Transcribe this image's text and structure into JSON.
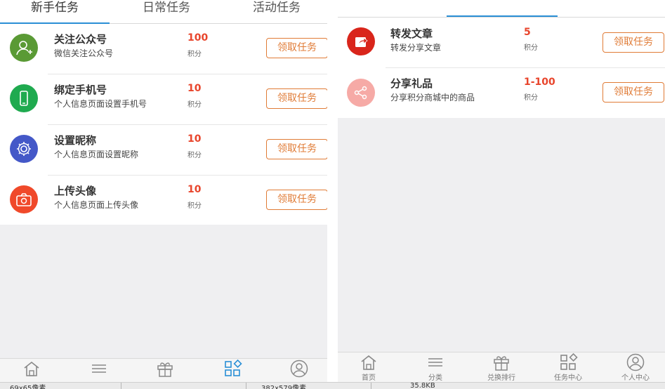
{
  "left_panel": {
    "tabs": [
      {
        "label": "新手任务",
        "active": true
      },
      {
        "label": "日常任务",
        "active": false
      },
      {
        "label": "活动任务",
        "active": false
      }
    ],
    "tasks": [
      {
        "title": "关注公众号",
        "desc": "微信关注公众号",
        "points": "100",
        "unit": "积分",
        "button": "领取任务",
        "icon": "user-add-icon",
        "color": "#5a9a35"
      },
      {
        "title": "绑定手机号",
        "desc": "个人信息页面设置手机号",
        "points": "10",
        "unit": "积分",
        "button": "领取任务",
        "icon": "phone-icon",
        "color": "#1faa4f"
      },
      {
        "title": "设置昵称",
        "desc": "个人信息页面设置昵称",
        "points": "10",
        "unit": "积分",
        "button": "领取任务",
        "icon": "gear-icon",
        "color": "#4458c8"
      },
      {
        "title": "上传头像",
        "desc": "个人信息页面上传头像",
        "points": "10",
        "unit": "积分",
        "button": "领取任务",
        "icon": "camera-icon",
        "color": "#f0492a"
      }
    ],
    "nav": [
      {
        "icon": "home-icon",
        "label": ""
      },
      {
        "icon": "menu-icon",
        "label": ""
      },
      {
        "icon": "gift-icon",
        "label": ""
      },
      {
        "icon": "task-grid-icon",
        "label": "",
        "active": true
      },
      {
        "icon": "user-icon",
        "label": ""
      }
    ]
  },
  "right_panel": {
    "tasks": [
      {
        "title": "转发文章",
        "desc": "转发分享文章",
        "points": "5",
        "unit": "积分",
        "button": "领取任务",
        "icon": "share-arrow-icon",
        "color": "#d9251b"
      },
      {
        "title": "分享礼品",
        "desc": "分享积分商城中的商品",
        "points": "1-100",
        "unit": "积分",
        "button": "领取任务",
        "icon": "share-icon",
        "color": "#f6aaa6"
      }
    ],
    "nav": [
      {
        "icon": "home-icon",
        "label": "首页"
      },
      {
        "icon": "menu-icon",
        "label": "分类"
      },
      {
        "icon": "gift-icon",
        "label": "兑换排行"
      },
      {
        "icon": "task-grid-icon",
        "label": "任务中心"
      },
      {
        "icon": "user-icon",
        "label": "个人中心"
      }
    ]
  },
  "statusbar": {
    "items": [
      "69x65像素",
      "382x579像素",
      "35.8KB"
    ]
  },
  "colors": {
    "accent": "#2a8fd6",
    "points": "#e8452c",
    "button": "#e07b36"
  }
}
